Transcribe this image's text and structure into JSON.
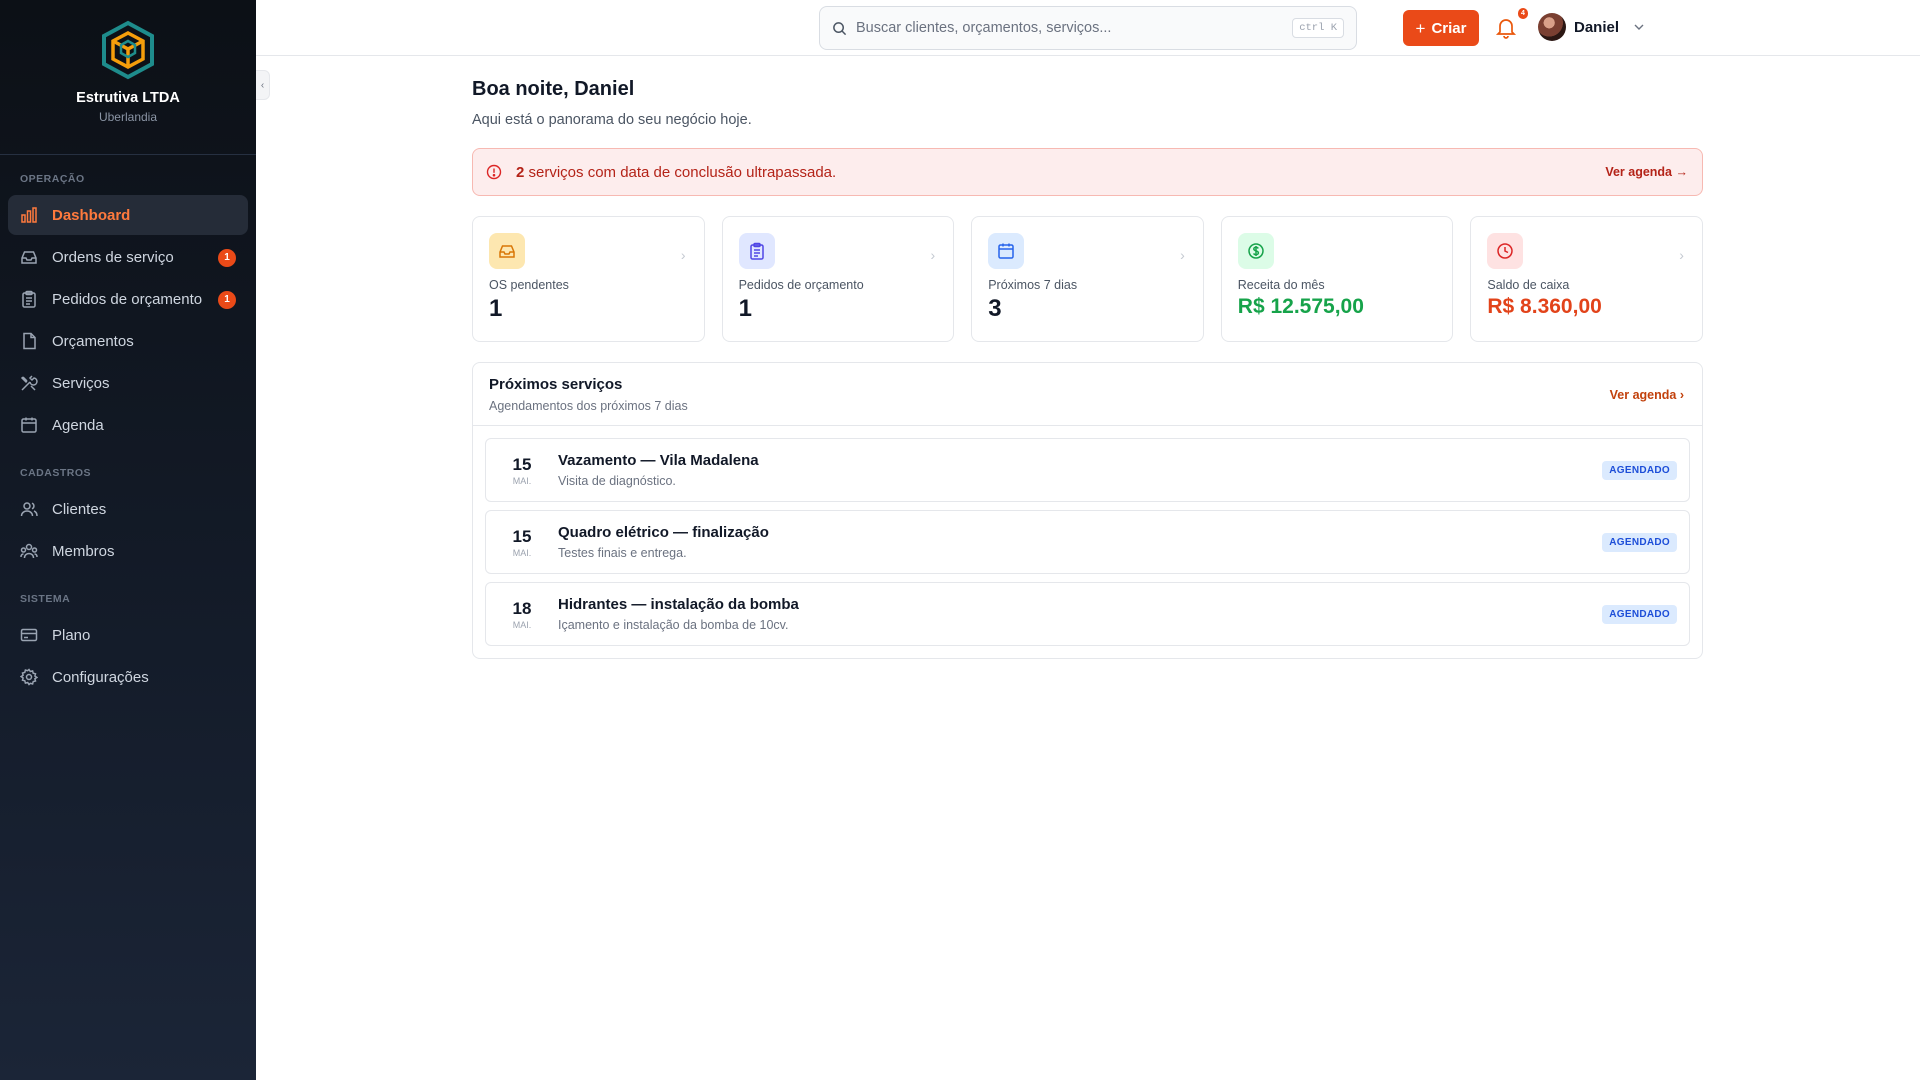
{
  "company": {
    "name": "Estrutiva LTDA",
    "city": "Uberlandia"
  },
  "nav": {
    "section_operacao": "OPERAÇÃO",
    "section_cadastros": "CADASTROS",
    "section_sistema": "SISTEMA",
    "items": [
      {
        "label": "Dashboard",
        "icon": "bar-chart-icon",
        "active": true
      },
      {
        "label": "Ordens de serviço",
        "icon": "inbox-icon",
        "badge": "1"
      },
      {
        "label": "Pedidos de orçamento",
        "icon": "clipboard-icon",
        "badge": "1"
      },
      {
        "label": "Orçamentos",
        "icon": "document-icon"
      },
      {
        "label": "Serviços",
        "icon": "tools-icon"
      },
      {
        "label": "Agenda",
        "icon": "calendar-icon"
      },
      {
        "label": "Clientes",
        "icon": "users-icon"
      },
      {
        "label": "Membros",
        "icon": "members-icon"
      },
      {
        "label": "Plano",
        "icon": "credit-card-icon"
      },
      {
        "label": "Configurações",
        "icon": "gear-icon"
      }
    ]
  },
  "topbar": {
    "search_placeholder": "Buscar clientes, orçamentos, serviços...",
    "shortcut": "ctrl K",
    "create_label": "Criar",
    "notifications_count": "4",
    "user_name": "Daniel"
  },
  "header": {
    "greeting": "Boa noite, Daniel",
    "subtitle": "Aqui está o panorama do seu negócio hoje."
  },
  "alert": {
    "count": "2",
    "message": " serviços com data de conclusão ultrapassada.",
    "link": "Ver agenda →"
  },
  "stats": [
    {
      "label": "OS pendentes",
      "value": "1",
      "icon": "inbox-icon",
      "color": "#fde7b0"
    },
    {
      "label": "Pedidos de orçamento",
      "value": "1",
      "icon": "clipboard-icon",
      "color": "#e0e7ff"
    },
    {
      "label": "Próximos 7 dias",
      "value": "3",
      "icon": "calendar-icon",
      "color": "#dbeafe"
    },
    {
      "label": "Receita do mês",
      "value": "R$ 12.575,00",
      "icon": "dollar-icon",
      "color": "#dcfce7"
    },
    {
      "label": "Saldo de caixa",
      "value": "R$ 8.360,00",
      "icon": "clock-icon",
      "color": "#fee2e2"
    }
  ],
  "upcoming": {
    "title": "Próximos serviços",
    "subtitle": "Agendamentos dos próximos 7 dias",
    "link": "Ver agenda",
    "items": [
      {
        "day": "15",
        "month": "MAI.",
        "title": "Vazamento — Vila Madalena",
        "desc": "Visita de diagnóstico.",
        "status": "AGENDADO"
      },
      {
        "day": "15",
        "month": "MAI.",
        "title": "Quadro elétrico — finalização",
        "desc": "Testes finais e entrega.",
        "status": "AGENDADO"
      },
      {
        "day": "18",
        "month": "MAI.",
        "title": "Hidrantes — instalação da bomba",
        "desc": "Içamento e instalação da bomba de 10cv.",
        "status": "AGENDADO"
      }
    ]
  }
}
